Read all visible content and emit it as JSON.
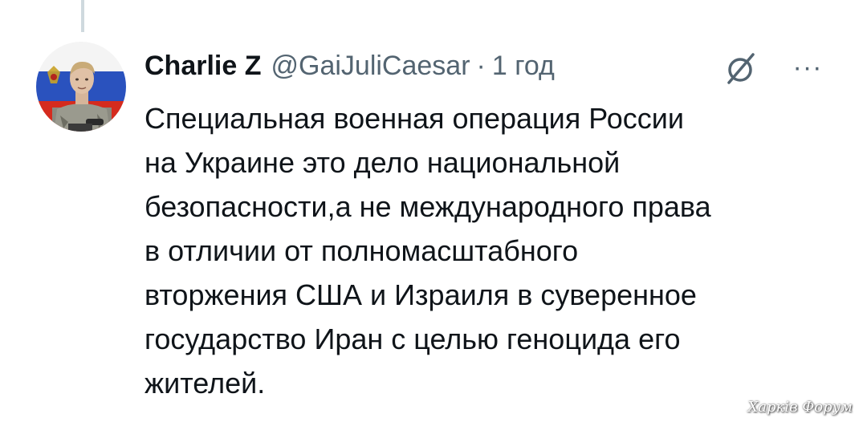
{
  "tweet": {
    "author": {
      "display_name": "Charlie Z",
      "handle": "@GaiJuliCaesar",
      "separator": "·",
      "time": "1 год"
    },
    "icons": {
      "grok": "grok-icon",
      "more": "more-options-icon"
    },
    "more_label": "···",
    "body_lines": [
      "Специальная военная операция России",
      "на Украине это дело национальной",
      "безопасности,а не международного права",
      "в отличии от полномасштабного",
      "вторжения США и Израиля в суверенное",
      "государство Иран с целью геноцида его",
      "жителей."
    ]
  },
  "watermark": "Харків Форум",
  "colors": {
    "text_primary": "#0f1419",
    "text_secondary": "#536471",
    "thread_line": "#cfd9de",
    "background": "#ffffff"
  }
}
